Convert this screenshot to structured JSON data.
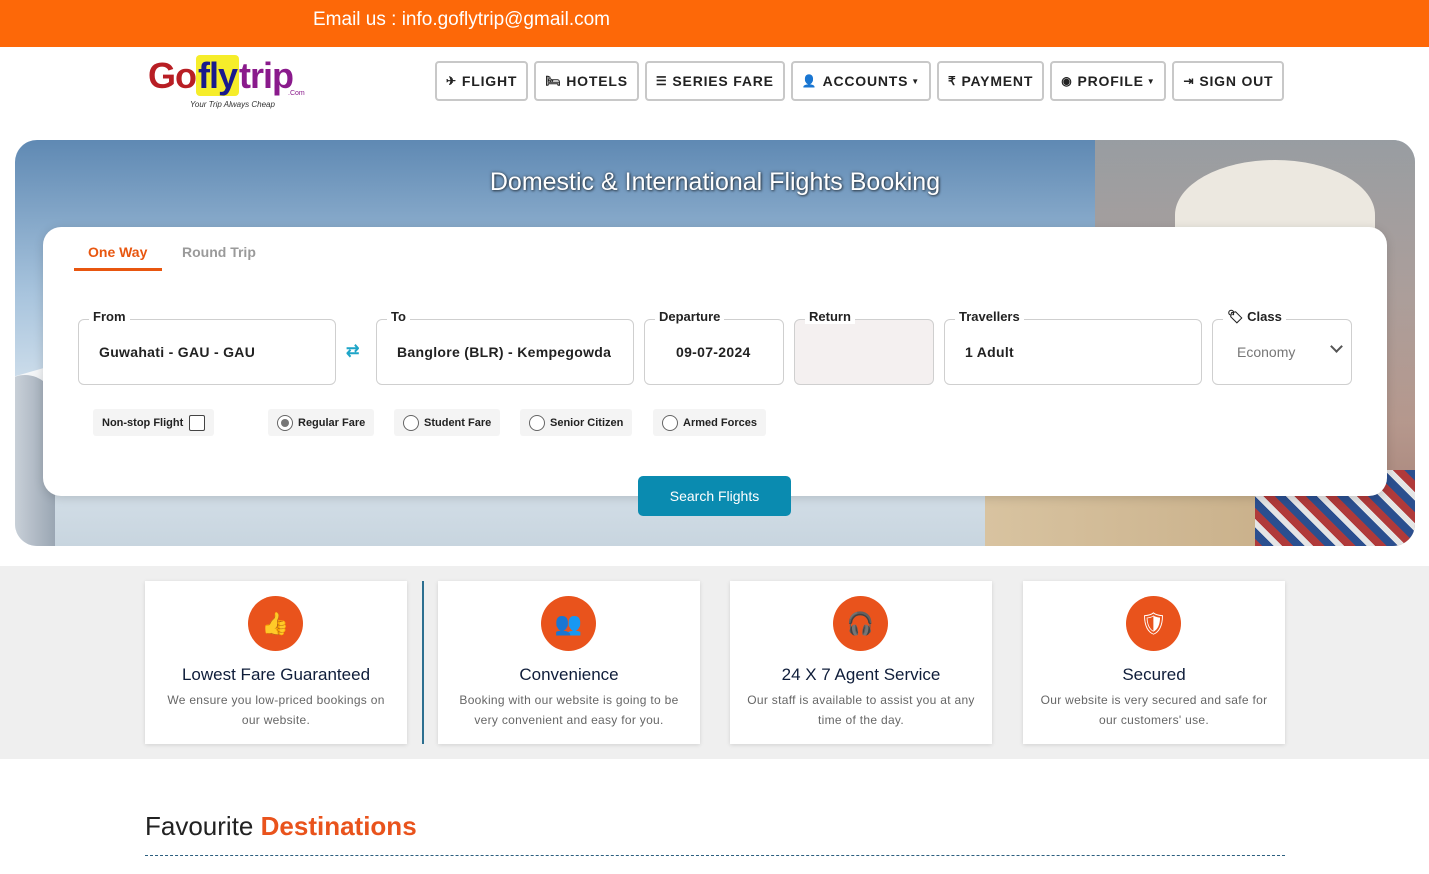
{
  "topbar": {
    "email": "Email us : info.goflytrip@gmail.com"
  },
  "logo": {
    "g": "Go",
    "fly": "fly",
    "trip": "trip",
    "com": ".Com",
    "tagline": "Your Trip Always Cheap"
  },
  "nav": [
    {
      "label": "FLIGHT",
      "icon": "plane-icon"
    },
    {
      "label": "HOTELS",
      "icon": "bed-icon"
    },
    {
      "label": "SERIES FARE",
      "icon": "list-icon"
    },
    {
      "label": "ACCOUNTS",
      "icon": "user-icon"
    },
    {
      "label": "PAYMENT",
      "icon": "rupee-icon"
    },
    {
      "label": "PROFILE",
      "icon": "profile-icon"
    },
    {
      "label": "SIGN OUT",
      "icon": "sign-out-icon"
    }
  ],
  "hero": {
    "title": "Domestic & International Flights Booking"
  },
  "search": {
    "tabs": {
      "one_way": "One Way",
      "round_trip": "Round Trip"
    },
    "from": {
      "label": "From",
      "value": "Guwahati - GAU - GAU"
    },
    "to": {
      "label": "To",
      "value": "Banglore (BLR) - Kempegowda"
    },
    "departure": {
      "label": "Departure",
      "value": "09-07-2024"
    },
    "return": {
      "label": "Return",
      "value": ""
    },
    "travellers": {
      "label": "Travellers",
      "value": "1 Adult"
    },
    "class": {
      "label": "Class",
      "value": "Economy"
    },
    "nonstop": "Non-stop Flight",
    "fares": [
      "Regular Fare",
      "Student Fare",
      "Senior Citizen",
      "Armed Forces"
    ],
    "selected_fare": "Regular Fare",
    "button": "Search Flights"
  },
  "features": [
    {
      "title": "Lowest Fare Guaranteed",
      "desc": "We ensure you low-priced bookings on our website.",
      "icon": "thumbs-up-icon"
    },
    {
      "title": "Convenience",
      "desc": "Booking with our website is going to be very convenient and easy for you.",
      "icon": "users-icon"
    },
    {
      "title": "24 X 7 Agent Service",
      "desc": "Our staff is available to assist you at any time of the day.",
      "icon": "headset-icon"
    },
    {
      "title": "Secured",
      "desc": "Our website is very secured and safe for our customers' use.",
      "icon": "shield-icon"
    }
  ],
  "destinations": {
    "title_plain": "Favourite",
    "title_highlight": "Destinations"
  },
  "colors": {
    "brand_orange": "#fd6808",
    "accent": "#e9531c",
    "search_button": "#0a8bb0"
  }
}
